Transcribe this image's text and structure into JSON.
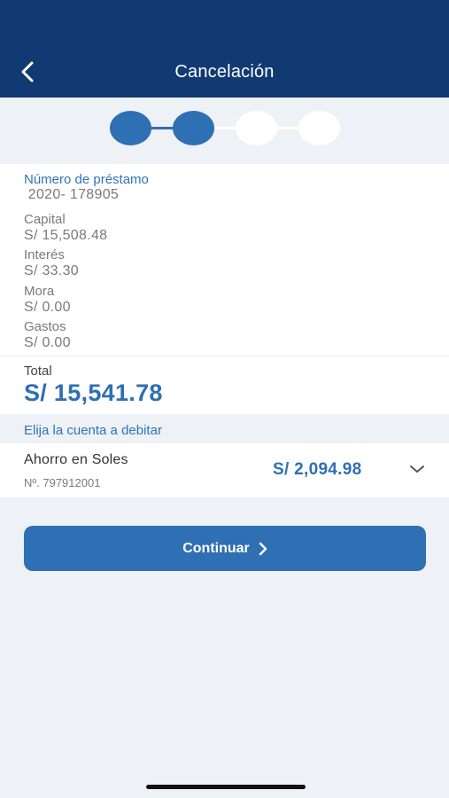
{
  "header": {
    "title": "Cancelación",
    "back_icon": "chevron-left-icon",
    "background": "#123a72"
  },
  "stepper": {
    "total_steps": 4,
    "completed_steps": 2,
    "active_color": "#2f6fb3",
    "inactive_color": "#ffffff"
  },
  "loan": {
    "number_label": "Número de préstamo",
    "number_value": " 2020- 178905",
    "capital_label": "Capital",
    "capital_value": "S/ 15,508.48",
    "interest_label": "Interés",
    "interest_value": "S/ 33.30",
    "mora_label": "Mora",
    "mora_value": "S/ 0.00",
    "gastos_label": "Gastos",
    "gastos_value": "S/ 0.00"
  },
  "total": {
    "label": "Total",
    "value": "S/ 15,541.78"
  },
  "debit": {
    "section_label": "Elija la cuenta a debitar",
    "account_name": "Ahorro en Soles",
    "account_number": "Nº. 797912001",
    "account_balance": "S/ 2,094.98",
    "dropdown_icon": "chevron-down-icon"
  },
  "actions": {
    "continue_label": "Continuar",
    "continue_icon": "chevron-right-icon",
    "button_color": "#2f6fb3"
  }
}
